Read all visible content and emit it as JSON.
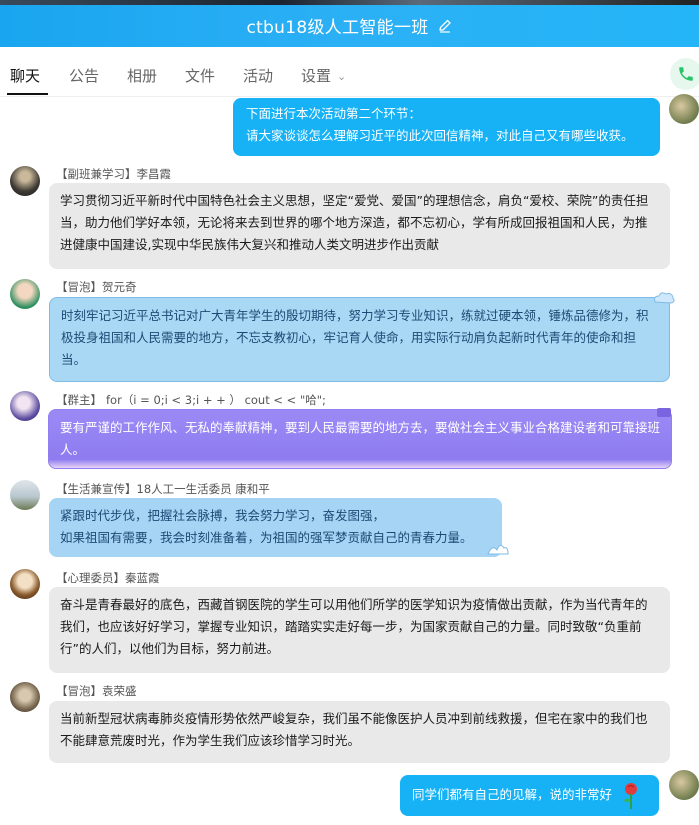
{
  "header": {
    "title": "ctbu18级人工智能一班",
    "edit_icon": "edit-icon"
  },
  "tabs": [
    {
      "label": "聊天",
      "active": true
    },
    {
      "label": "公告"
    },
    {
      "label": "相册"
    },
    {
      "label": "文件"
    },
    {
      "label": "活动"
    },
    {
      "label": "设置"
    }
  ],
  "messages": [
    {
      "sender_tag": "",
      "sender": "",
      "text_lines": [
        "下面进行本次活动第二个环节：",
        "请大家谈谈怎么理解习近平的此次回信精神，对此自己又有哪些收获。"
      ],
      "self": true
    },
    {
      "sender_tag": "【副班兼学习】",
      "sender": "李昌霞",
      "text": "学习贯彻习近平新时代中国特色社会主义思想，坚定“爱党、爱国”的理想信念，肩负“爱校、荣院”的责任担当，助力他们学好本领，无论将来去到世界的哪个地方深造，都不忘初心，学有所成回报祖国和人民，为推进健康中国建设,实现中华民族伟大复兴和推动人类文明进步作出贡献"
    },
    {
      "sender_tag": "【冒泡】",
      "sender": "贺元奇",
      "text": "时刻牢记习近平总书记对广大青年学生的殷切期待，努力学习专业知识，练就过硬本领，锤炼品德修为，积极投身祖国和人民需要的地方，不忘支教初心，牢记育人使命，用实际行动肩负起新时代青年的使命和担当。"
    },
    {
      "sender_tag": "【群主】",
      "sender": "for（i = 0;i < 3;i + + ）  cout < < \"哈\";",
      "text": "要有严谨的工作作风、无私的奉献精神，要到人民最需要的地方去，要做社会主义事业合格建设者和可靠接班人。"
    },
    {
      "sender_tag": "【生活兼宣传】",
      "sender": "18人工一生活委员 康和平",
      "text_lines": [
        "紧跟时代步伐，把握社会脉搏，我会努力学习，奋发图强，",
        "如果祖国有需要，我会时刻准备着，为祖国的强军梦贡献自己的青春力量。"
      ]
    },
    {
      "sender_tag": "【心理委员】",
      "sender": "秦蓝霞",
      "text": "奋斗是青春最好的底色，西藏首钢医院的学生可以用他们所学的医学知识为疫情做出贡献，作为当代青年的我们，也应该好好学习，掌握专业知识，踏踏实实走好每一步，为国家贡献自己的力量。同时致敬“负重前行”的人们，以他们为目标，努力前进。"
    },
    {
      "sender_tag": "【冒泡】",
      "sender": "袁荣盛",
      "text": "当前新型冠状病毒肺炎疫情形势依然严峻复杂，我们虽不能像医护人员冲到前线救援，但宅在家中的我们也不能肆意荒废时光，作为学生我们应该珍惜学习时光。"
    },
    {
      "sender_tag": "",
      "sender": "",
      "text": "同学们都有自己的见解，说的非常好",
      "self": true,
      "emoji": "rose"
    }
  ],
  "colors": {
    "header": "#1aa5f0",
    "self_bubble": "#16b2f5",
    "other_bubble": "#e9e9ea",
    "call": "#2ac36a"
  }
}
